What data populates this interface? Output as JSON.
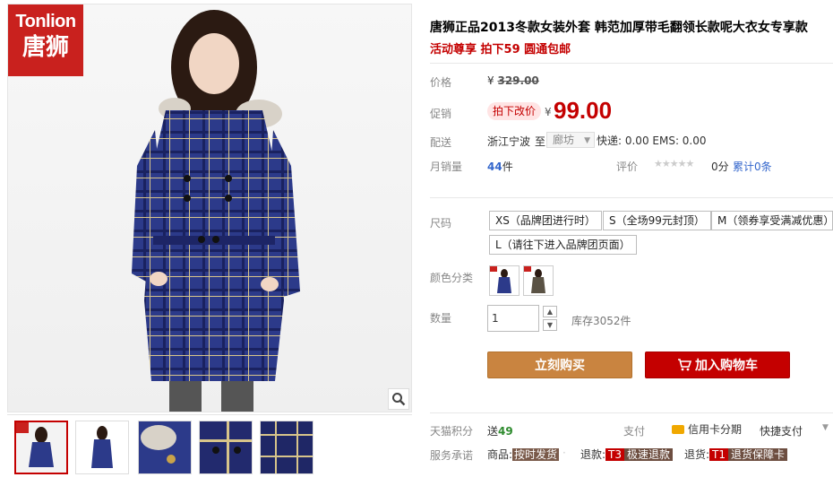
{
  "brand": {
    "logo_en": "Tonlion",
    "logo_cn": "唐狮"
  },
  "gallery": {
    "thumb_count": 5,
    "active_thumb": 0
  },
  "product": {
    "title": "唐狮正品2013冬款女装外套 韩范加厚带毛翻领长款呢大衣女专享款",
    "promo": "活动尊享 拍下59 圆通包邮"
  },
  "price": {
    "label": "价格",
    "currency": "¥",
    "original": "329.00",
    "promo_label": "促销",
    "promo_tag": "拍下改价",
    "promo_price": "99.00"
  },
  "shipping": {
    "label": "配送",
    "from": "浙江宁波",
    "to_word": "至",
    "to": "廊坊",
    "fees": "快递: 0.00 EMS: 0.00"
  },
  "sales": {
    "label": "月销量",
    "count": "44",
    "unit": "件",
    "rating_label": "评价",
    "stars": "★★★★★",
    "score": "0分",
    "reviews": "累计0条"
  },
  "sizes": {
    "label": "尺码",
    "options": [
      "XS（品牌团进行时）",
      "S（全场99元封顶）",
      "M（领券享受满减优惠）",
      "L（请往下进入品牌团页面）"
    ]
  },
  "colors": {
    "label": "颜色分类",
    "count": 2
  },
  "quantity": {
    "label": "数量",
    "value": "1",
    "stock": "库存3052件"
  },
  "buttons": {
    "buy": "立刻购买",
    "cart": "加入购物车"
  },
  "points": {
    "label": "天猫积分",
    "send": "送",
    "value": "49"
  },
  "payment": {
    "label": "支付",
    "credit": "信用卡分期",
    "quick": "快捷支付"
  },
  "service": {
    "label": "服务承诺",
    "goods": "商品:",
    "goods_tag": "按时发货",
    "refund": "退款:",
    "refund_code": "T3",
    "refund_tag": "极速退款",
    "return": "退货:",
    "return_code": "T1",
    "return_tag": "退货保障卡"
  },
  "colors_theme": {
    "accent": "#c40000",
    "buy": "#c98440",
    "cart": "#c40000"
  }
}
